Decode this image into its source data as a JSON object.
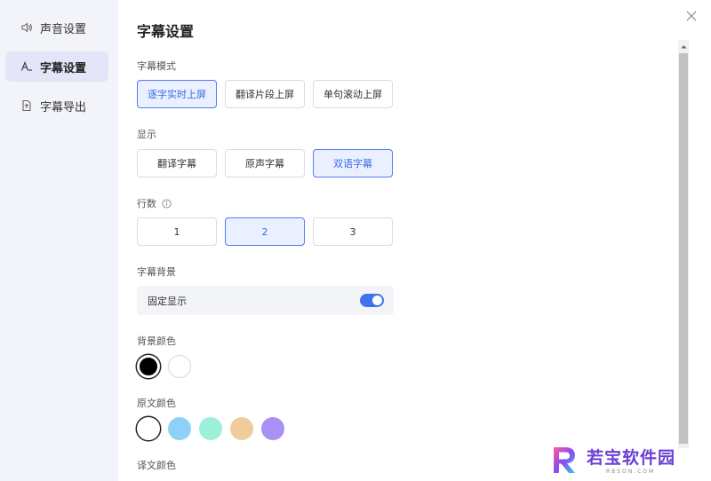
{
  "sidebar": {
    "items": [
      {
        "label": "声音设置",
        "icon": "speaker-icon",
        "active": false
      },
      {
        "label": "字幕设置",
        "icon": "subtitle-font-icon",
        "active": true
      },
      {
        "label": "字幕导出",
        "icon": "export-file-icon",
        "active": false
      }
    ]
  },
  "main": {
    "title": "字幕设置",
    "mode": {
      "label": "字幕模式",
      "options": [
        "逐字实时上屏",
        "翻译片段上屏",
        "单句滚动上屏"
      ],
      "selected": "逐字实时上屏"
    },
    "display": {
      "label": "显示",
      "options": [
        "翻译字幕",
        "原声字幕",
        "双语字幕"
      ],
      "selected": "双语字幕"
    },
    "lines": {
      "label": "行数",
      "options": [
        "1",
        "2",
        "3"
      ],
      "selected": "2"
    },
    "background": {
      "label": "字幕背景",
      "toggle_label": "固定显示",
      "toggle_on": true
    },
    "bg_color": {
      "label": "背景颜色",
      "colors": [
        "#000000",
        "#ffffff"
      ],
      "selected": "#000000"
    },
    "source_color": {
      "label": "原文颜色",
      "colors": [
        "#ffffff",
        "#8fd0f8",
        "#9af0d8",
        "#f0cc9c",
        "#a890f4"
      ],
      "selected": "#ffffff"
    },
    "translation_color": {
      "label": "译文颜色"
    }
  },
  "watermark": {
    "main": "若宝软件园",
    "sub": "RBSON.COM"
  },
  "colors": {
    "accent": "#3f73ee",
    "selected_bg": "#eaf0ff",
    "sidebar_bg": "#f3f4f9"
  }
}
